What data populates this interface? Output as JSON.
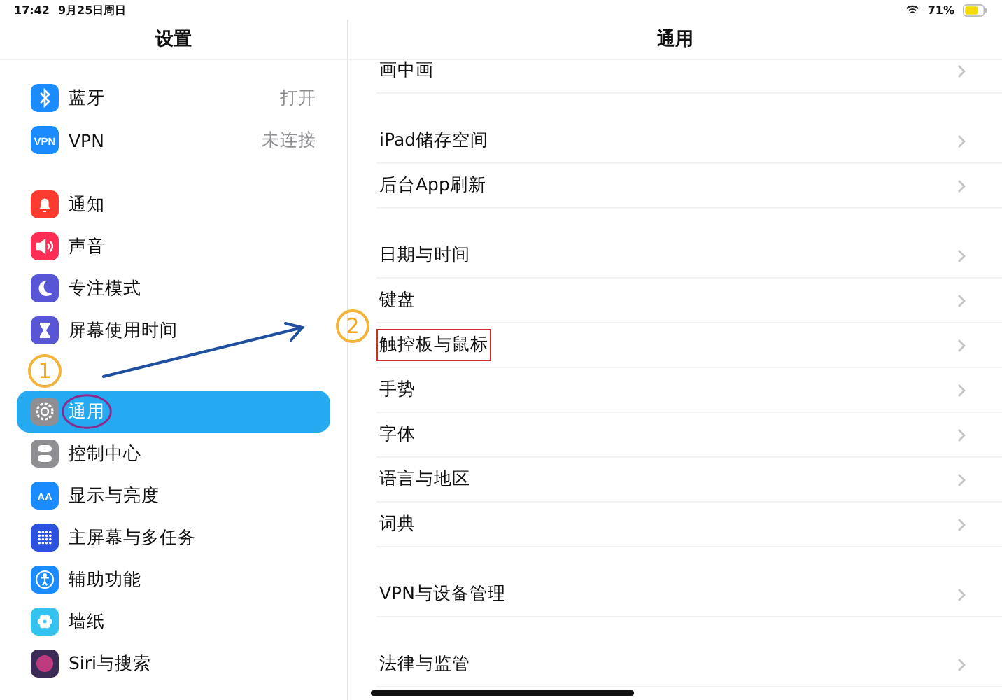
{
  "status_bar": {
    "time": "17:42",
    "date": "9月25日周日",
    "battery_text": "71%"
  },
  "sidebar": {
    "title": "设置",
    "groups": [
      {
        "items": [
          {
            "label": "蓝牙",
            "value": "打开",
            "kind": "bluetooth",
            "color": "#1a8cff",
            "selected": false,
            "circled": false
          },
          {
            "label": "VPN",
            "value": "未连接",
            "kind": "text",
            "icon_text": "VPN",
            "color": "#1a8cff",
            "selected": false,
            "circled": false
          }
        ]
      },
      {
        "items": [
          {
            "label": "通知",
            "kind": "bell",
            "color": "#ff3b30",
            "selected": false,
            "circled": false
          },
          {
            "label": "声音",
            "kind": "speaker",
            "color": "#ff2d55",
            "selected": false,
            "circled": false
          },
          {
            "label": "专注模式",
            "kind": "moon",
            "color": "#5856d6",
            "selected": false,
            "circled": false
          },
          {
            "label": "屏幕使用时间",
            "kind": "hourglass",
            "color": "#5856d6",
            "selected": false,
            "circled": false
          }
        ]
      },
      {
        "items": [
          {
            "label": "通用",
            "kind": "gear",
            "color": "#8e8e93",
            "selected": true,
            "circled": true,
            "marker": "1"
          },
          {
            "label": "控制中心",
            "kind": "toggles",
            "color": "#8e8e93",
            "selected": false,
            "circled": false
          },
          {
            "label": "显示与亮度",
            "kind": "text",
            "icon_text": "AA",
            "color": "#1a8cff",
            "selected": false,
            "circled": false
          },
          {
            "label": "主屏幕与多任务",
            "kind": "grid",
            "color": "#2c50e0",
            "selected": false,
            "circled": false
          },
          {
            "label": "辅助功能",
            "kind": "accessibility",
            "color": "#1a8cff",
            "selected": false,
            "circled": false
          },
          {
            "label": "墙纸",
            "kind": "flower",
            "color": "#34c3f0",
            "selected": false,
            "circled": false
          },
          {
            "label": "Siri与搜索",
            "kind": "siri",
            "color": "#3a2a55",
            "selected": false,
            "circled": false
          }
        ]
      }
    ]
  },
  "detail": {
    "title": "通用",
    "groups": [
      {
        "items": [
          {
            "label": "画中画",
            "boxed": false
          }
        ]
      },
      {
        "items": [
          {
            "label": "iPad储存空间",
            "boxed": false
          },
          {
            "label": "后台App刷新",
            "boxed": false
          }
        ]
      },
      {
        "items": [
          {
            "label": "日期与时间",
            "boxed": false
          },
          {
            "label": "键盘",
            "boxed": false
          },
          {
            "label": "触控板与鼠标",
            "boxed": true,
            "marker": "2"
          },
          {
            "label": "手势",
            "boxed": false
          },
          {
            "label": "字体",
            "boxed": false
          },
          {
            "label": "语言与地区",
            "boxed": false
          },
          {
            "label": "词典",
            "boxed": false
          }
        ]
      },
      {
        "items": [
          {
            "label": "VPN与设备管理",
            "boxed": false
          }
        ]
      },
      {
        "items": [
          {
            "label": "法律与监管",
            "boxed": false
          }
        ]
      }
    ]
  }
}
